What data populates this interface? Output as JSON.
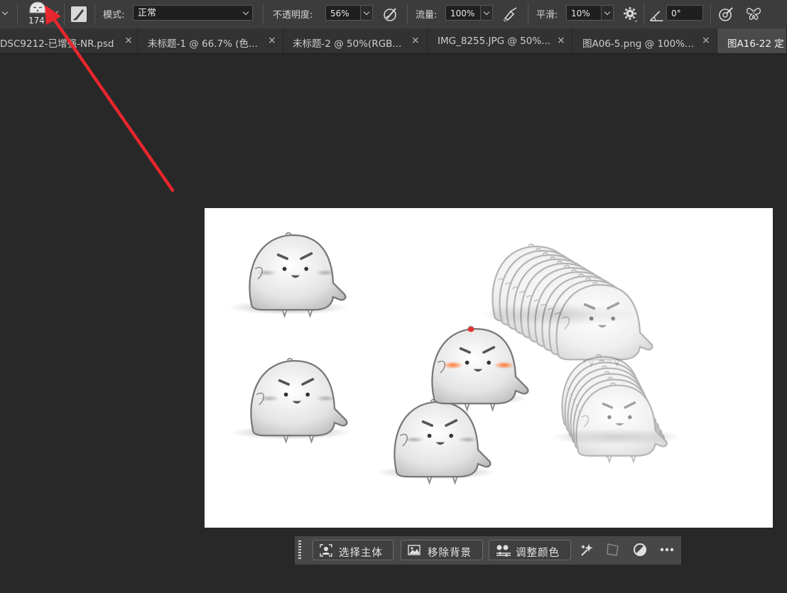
{
  "options_bar": {
    "brush_size": "174",
    "mode_label": "模式:",
    "mode_value": "正常",
    "opacity_label": "不透明度:",
    "opacity_value": "56%",
    "flow_label": "流量:",
    "flow_value": "100%",
    "smoothing_label": "平滑:",
    "smoothing_value": "10%",
    "angle_value": "0°",
    "icons": [
      "brush-preset-icon",
      "brush-panel-icon",
      "pressure-opacity-icon",
      "airbrush-icon",
      "settings-gear-icon",
      "angle-icon",
      "pressure-size-icon",
      "symmetry-butterfly-icon"
    ]
  },
  "tabs": [
    {
      "label": "DSC9212-已增强-NR.psd",
      "active": false
    },
    {
      "label": "未标题-1 @ 66.7% (色...",
      "active": false
    },
    {
      "label": "未标题-2 @ 50%(RGB...",
      "active": false
    },
    {
      "label": "IMG_8255.JPG @ 50%...",
      "active": false
    },
    {
      "label": "图A06-5.png @ 100%...",
      "active": false
    },
    {
      "label": "图A16-22 定",
      "active": true
    }
  ],
  "tab_close_glyph": "×",
  "contextual_taskbar": {
    "select_subject": "选择主体",
    "remove_background": "移除背景",
    "adjust_color": "调整颜色",
    "icons": [
      "grip-icon",
      "generative-sparkle-icon",
      "transform-icon",
      "adjustment-circle-icon",
      "more-options-icon"
    ]
  },
  "annotation": {
    "arrow_color": "#e8262d"
  },
  "colors": {
    "app_bg": "#282828",
    "bar_bg": "#3c3c3c",
    "blush": "#ff7a2e",
    "dot": "#e53131"
  }
}
